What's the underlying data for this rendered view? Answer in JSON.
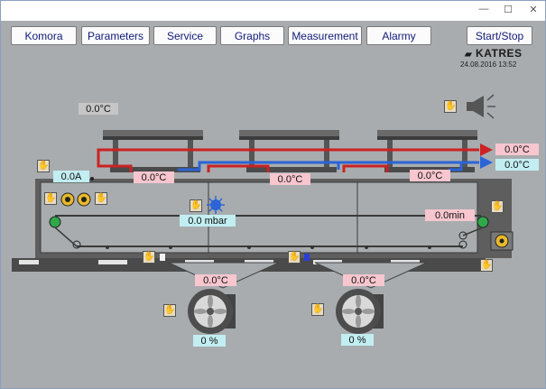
{
  "window": {
    "minimize_glyph": "—",
    "maximize_glyph": "☐",
    "close_glyph": "✕"
  },
  "nav": {
    "komora": "Komora",
    "parameters": "Parameters",
    "service": "Service",
    "graphs": "Graphs",
    "measurement": "Measurement",
    "alarmy": "Alarmy",
    "start_stop": "Start/Stop"
  },
  "brand": {
    "logo": "KATRES",
    "datetime": "24.08.2016  13:52"
  },
  "readouts": {
    "ambient_temp": "0.0°C",
    "supply_temp": "0.0°C",
    "return_temp": "0.0°C",
    "fan_current": "0.0A",
    "heater_temp_1": "0.0°C",
    "heater_temp_2": "0.0°C",
    "heater_temp_3": "0.0°C",
    "pressure": "0.0 mbar",
    "time": "0.0min",
    "blower_temp_1": "0.0°C",
    "blower_temp_2": "0.0°C",
    "blower_pct_1": "0 %",
    "blower_pct_2": "0 %"
  },
  "icons": {
    "manual_mode": "hand-icon",
    "alarm_horn": "speaker-icon",
    "pressure_pump": "pump-icon",
    "fan": "fan-icon"
  },
  "colors": {
    "background": "#a8acaf",
    "hot_pipe": "#cc2222",
    "cold_pipe": "#2a64d6",
    "temp_box": "#f7c6ce",
    "info_box": "#c2eef2",
    "nav_text": "#101a78"
  }
}
